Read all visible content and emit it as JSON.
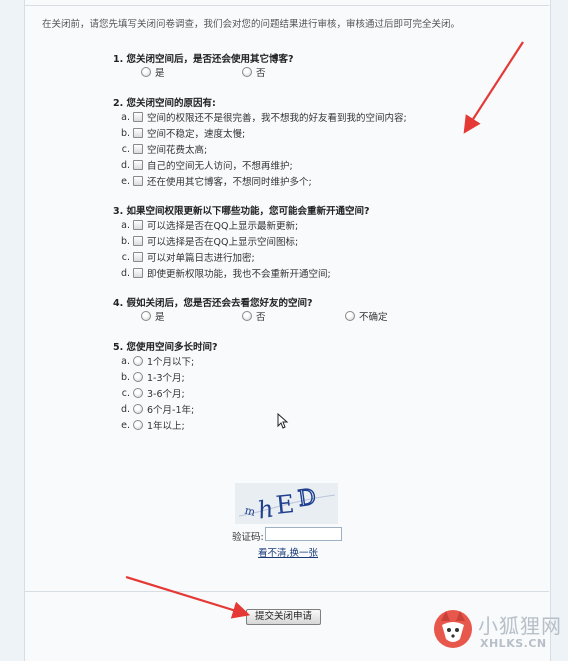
{
  "intro": "在关闭前，请您先填写关闭问卷调查，我们会对您的问题结果进行审核，审核通过后即可完全关闭。",
  "q1": {
    "title": "1. 您关闭空间后，是否还会使用其它博客?",
    "options": [
      "是",
      "否"
    ]
  },
  "q2": {
    "title": "2. 您关闭空间的原因有:",
    "items": [
      {
        "letter": "a.",
        "label": "空间的权限还不是很完善，我不想我的好友看到我的空间内容;"
      },
      {
        "letter": "b.",
        "label": "空间不稳定，速度太慢;"
      },
      {
        "letter": "c.",
        "label": "空间花费太高;"
      },
      {
        "letter": "d.",
        "label": "自己的空间无人访问，不想再维护;"
      },
      {
        "letter": "e.",
        "label": "还在使用其它博客，不想同时维护多个;"
      }
    ]
  },
  "q3": {
    "title": "3. 如果空间权限更新以下哪些功能，您可能会重新开通空间?",
    "items": [
      {
        "letter": "a.",
        "label": "可以选择是否在QQ上显示最新更新;"
      },
      {
        "letter": "b.",
        "label": "可以选择是否在QQ上显示空间图标;"
      },
      {
        "letter": "c.",
        "label": "可以对单篇日志进行加密;"
      },
      {
        "letter": "d.",
        "label": "即使更新权限功能，我也不会重新开通空间;"
      }
    ]
  },
  "q4": {
    "title": "4. 假如关闭后，您是否还会去看您好友的空间?",
    "options": [
      "是",
      "否",
      "不确定"
    ]
  },
  "q5": {
    "title": "5. 您使用空间多长时间?",
    "items": [
      {
        "letter": "a.",
        "label": "1个月以下;"
      },
      {
        "letter": "b.",
        "label": "1-3个月;"
      },
      {
        "letter": "c.",
        "label": "3-6个月;"
      },
      {
        "letter": "d.",
        "label": "6个月-1年;"
      },
      {
        "letter": "e.",
        "label": "1年以上;"
      }
    ]
  },
  "captcha": {
    "label": "验证码:",
    "input_value": "",
    "refresh_link": "看不清,换一张"
  },
  "submit_label": "提交关闭申请",
  "watermark": {
    "text": "小狐狸网",
    "url": "XHLKS.CN"
  },
  "colors": {
    "arrow": "#e53935",
    "link": "#1a3a7a",
    "captcha_ink": "#1f3f8f"
  }
}
